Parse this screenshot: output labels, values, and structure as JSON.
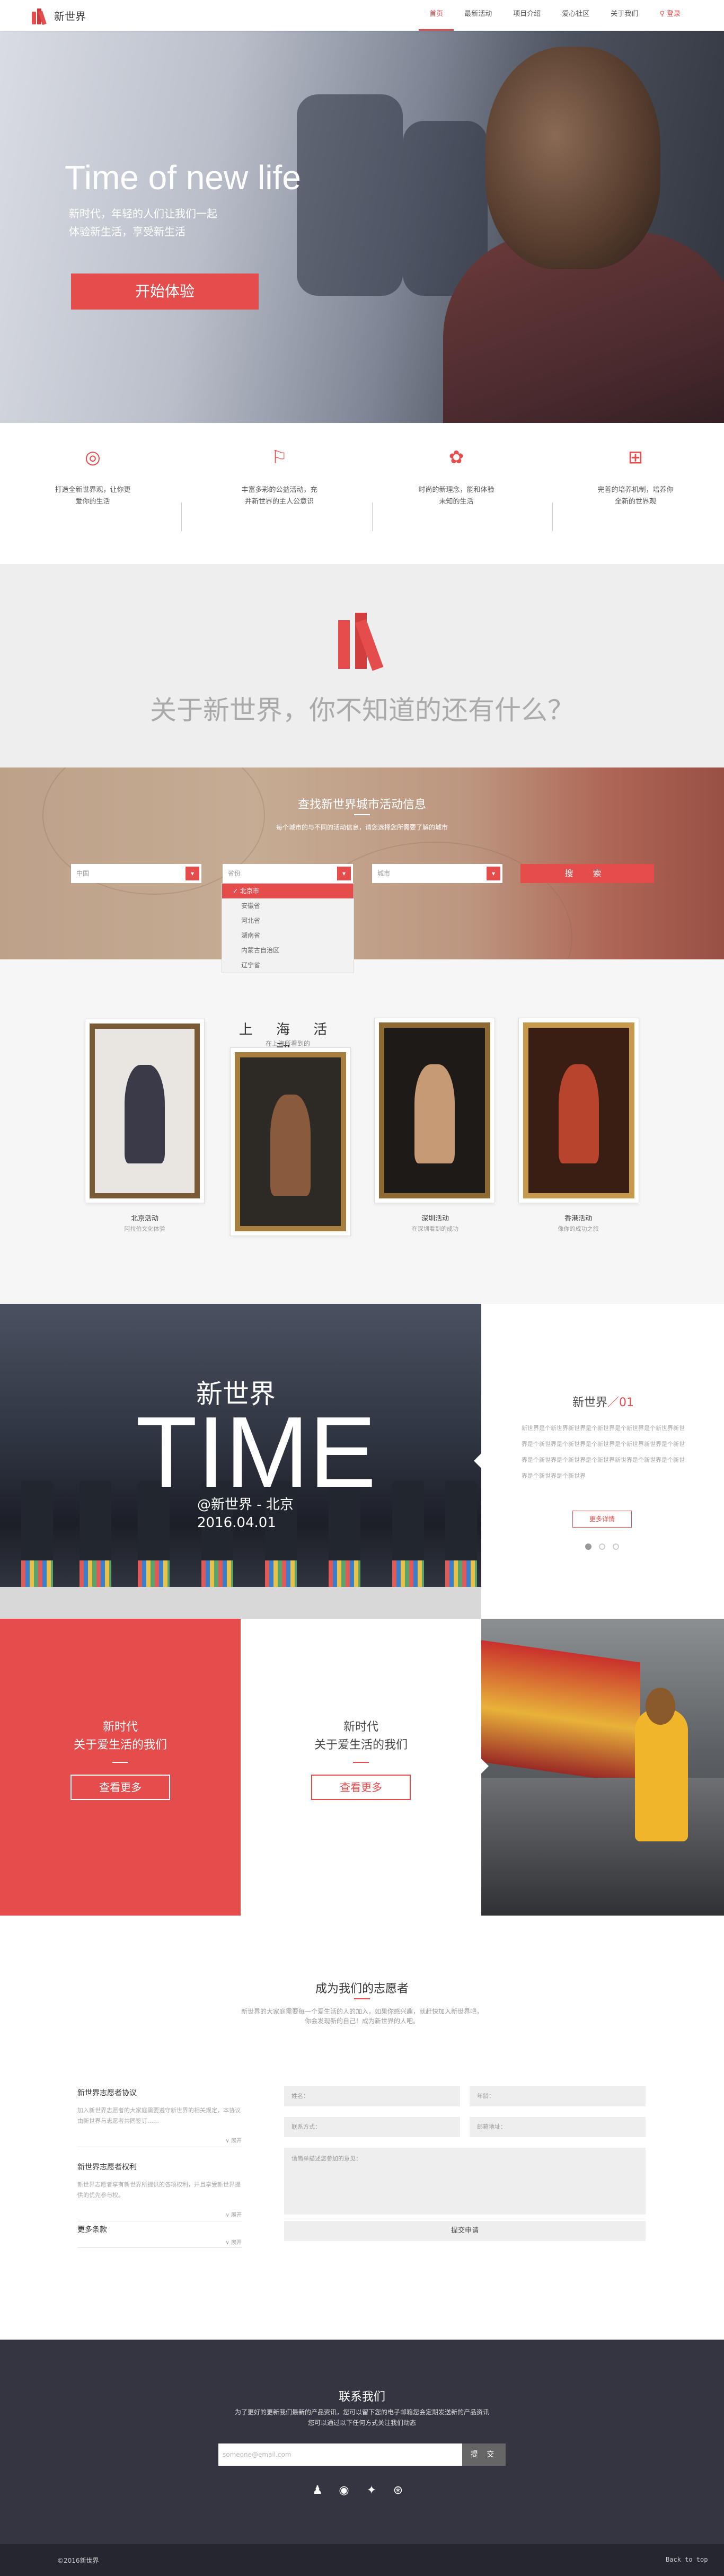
{
  "nav": {
    "logo_text": "新世界",
    "items": [
      {
        "label": "首页",
        "active": true
      },
      {
        "label": "最新活动",
        "active": false
      },
      {
        "label": "项目介绍",
        "active": false
      },
      {
        "label": "爱心社区",
        "active": false
      },
      {
        "label": "关于我们",
        "active": false
      }
    ],
    "login": "登录"
  },
  "hero": {
    "title": "Time of new life",
    "sub1": "新时代，年轻的人们让我们一起",
    "sub2": "体验新生活，享受新生活",
    "button": "开始体验"
  },
  "features": [
    {
      "icon": "target-icon",
      "line1": "打造全新世界观，让你更",
      "line2": "爱你的生活"
    },
    {
      "icon": "flag-icon",
      "line1": "丰富多彩的公益活动，充",
      "line2": "并新世界的主人公意识"
    },
    {
      "icon": "flower-icon",
      "line1": "时尚的新理念，能和体验",
      "line2": "未知的生活"
    },
    {
      "icon": "grid-icon",
      "line1": "完善的培养机制，培养你",
      "line2": "全新的世界观"
    }
  ],
  "about": {
    "title": "关于新世界，你不知道的还有什么？"
  },
  "search": {
    "title": "查找新世界城市活动信息",
    "subtitle": "每个城市的与不同的活动信息，请您选择您所需要了解的城市",
    "select_country": "中国",
    "select_province": "省份",
    "select_city": "城市",
    "button": "搜 索",
    "province_options": [
      "北京市",
      "安徽省",
      "河北省",
      "湖南省",
      "内蒙古自治区",
      "辽宁省"
    ]
  },
  "gallery": {
    "title": "上 海 活 动",
    "subtitle": "在上海所看到的",
    "cards": [
      {
        "caption": "北京活动",
        "sub": "阿拉伯文化体验"
      },
      {
        "caption": "",
        "sub": ""
      },
      {
        "caption": "深圳活动",
        "sub": "在深圳看到的成功"
      },
      {
        "caption": "香港活动",
        "sub": "像你的成功之旅"
      }
    ]
  },
  "time": {
    "line1": "新世界",
    "line2": "TIME",
    "line3": "@新世界 - 北京",
    "line4": "2016.04.01",
    "panel_title": "新世界",
    "panel_title_accent": "／01",
    "panel_text": "新世界是个新世界新世界是个新世界是个新世界是个新世界新世界是个新世界是个新世界是个新世界是个新世界新世界是个新世界是个新世界是个新世界是个新世界新世界是个新世界是个新世界是个新世界是个新世界",
    "panel_button": "更多详情"
  },
  "promos": [
    {
      "line1": "新时代",
      "line2": "关于爱生活的我们",
      "button": "查看更多"
    },
    {
      "line1": "新时代",
      "line2": "关于爱生活的我们",
      "button": "查看更多"
    }
  ],
  "volunteer": {
    "title": "成为我们的志愿者",
    "subtitle": "新世界的大家庭需要每一个爱生活的人的加入，如果你感兴趣，就赶快加入新世界吧，你会发现新的自己！成为新世界的人吧。",
    "agreements": [
      {
        "title": "新世界志愿者协议",
        "text": "加入新世界志愿者的大家庭需要遵守新世界的相关规定，本协议由新世界与志愿者共同签订……",
        "unfold": "∨ 展开"
      },
      {
        "title": "新世界志愿者权利",
        "text": "新世界志愿者享有新世界所提供的各项权利，并且享受新世界提供的优先参与权。",
        "unfold": "∨ 展开"
      },
      {
        "title": "更多条款",
        "text": "",
        "unfold": "∨ 展开"
      }
    ],
    "form": {
      "name": "姓名：",
      "age": "年龄：",
      "contact": "联系方式：",
      "email": "邮箱地址：",
      "message": "请简单描述您参加的意见：",
      "submit": "提交申请"
    }
  },
  "footer": {
    "title": "联系我们",
    "sub1": "为了更好的更新我们最新的产品资讯，您可以留下您的电子邮箱您会定期发送新的产品资讯",
    "sub2": "您可以通过以下任何方式关注我们动态",
    "email_placeholder": "someone@email.com",
    "submit": "提 交",
    "social": [
      "qq-icon",
      "weibo-icon",
      "twitter-icon",
      "dribbble-icon"
    ],
    "copyright": "©2016新世界",
    "back_to_top": "Back to top"
  },
  "colors": {
    "accent": "#e54c4c",
    "footer": "#343541"
  }
}
